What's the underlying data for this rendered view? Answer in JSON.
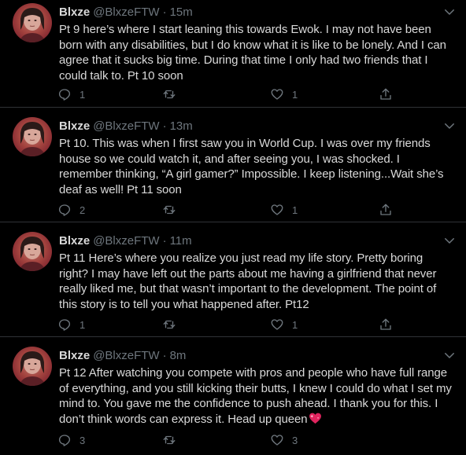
{
  "tweets": [
    {
      "name": "Blxze",
      "handle": "@BlxzeFTW",
      "separator": "·",
      "time": "15m",
      "text": "Pt 9 here’s where I start leaning this towards Ewok. I may not have been born with any disabilities, but I do know what it is like to be lonely. And I can agree that it sucks big time. During that time I only had two friends that I could talk to. Pt 10 soon",
      "replies": "1",
      "retweets": "",
      "likes": "1"
    },
    {
      "name": "Blxze",
      "handle": "@BlxzeFTW",
      "separator": "·",
      "time": "13m",
      "text": "Pt 10. This was when I first saw you in World Cup. I was over my friends house so we could watch it, and after seeing you, I was shocked. I remember thinking, “A girl gamer?” Impossible. I keep listening...Wait she’s deaf as well! Pt 11 soon",
      "replies": "2",
      "retweets": "",
      "likes": "1"
    },
    {
      "name": "Blxze",
      "handle": "@BlxzeFTW",
      "separator": "·",
      "time": "11m",
      "text": "Pt 11 Here’s where you realize you just read my life story. Pretty boring right?  I may have left out the parts about me having a girlfriend that never really liked me, but that wasn’t important to the development. The point of this story is to tell you what happened after. Pt12",
      "replies": "1",
      "retweets": "",
      "likes": "1"
    },
    {
      "name": "Blxze",
      "handle": "@BlxzeFTW",
      "separator": "·",
      "time": "8m",
      "text": "Pt 12 After watching you compete with pros and people who have full range of everything, and you still kicking their butts, I knew I could do what I set my mind to. You gave me the confidence to push ahead. I thank you for this. I don’t think words can express it. Head up queen",
      "emoji": "heart-with-sparkles",
      "replies": "3",
      "retweets": "",
      "likes": "3"
    }
  ],
  "colors": {
    "background": "#000000",
    "text": "#d9d9d9",
    "secondary": "#6e767d",
    "divider": "#2f3336",
    "emoji": "#e0245e"
  }
}
